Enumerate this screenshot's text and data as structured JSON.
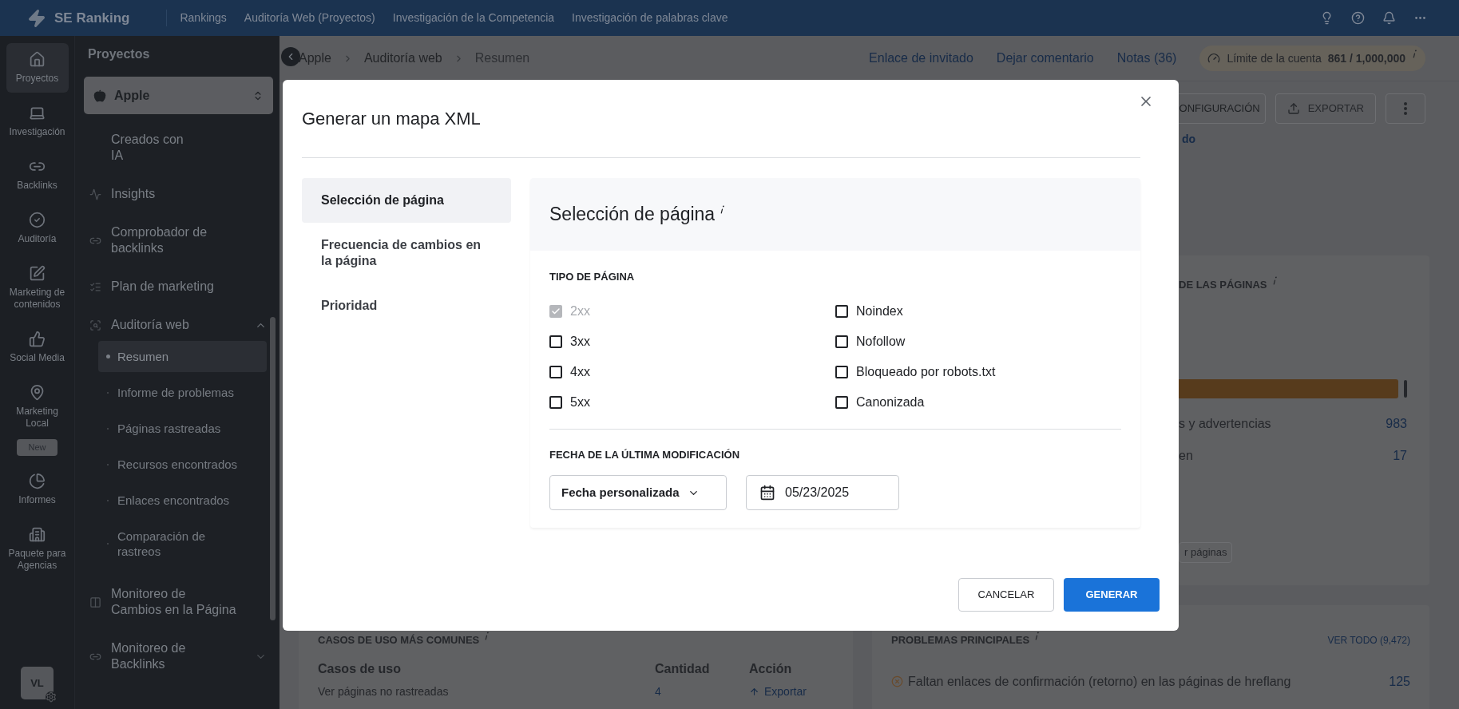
{
  "top_bar": {
    "logo": "SE Ranking",
    "nav": [
      "Rankings",
      "Auditoría Web (Proyectos)",
      "Investigación de la Competencia",
      "Investigación de palabras clave"
    ]
  },
  "icon_rail": {
    "items": [
      {
        "label": "Proyectos",
        "selected": true
      },
      {
        "label": "Investigación",
        "selected": false
      },
      {
        "label": "Backlinks",
        "selected": false
      },
      {
        "label": "Auditoría",
        "selected": false
      },
      {
        "label": "Marketing de contenidos",
        "selected": false
      },
      {
        "label": "Social Media",
        "selected": false
      },
      {
        "label": "Marketing Local",
        "selected": false,
        "badge": "New"
      },
      {
        "label": "Informes",
        "selected": false
      },
      {
        "label": "Paquete para Agencias",
        "selected": false
      }
    ],
    "avatar": "VL"
  },
  "sidebar": {
    "title": "Proyectos",
    "project": "Apple",
    "items": [
      {
        "label": "Creados con IA"
      },
      {
        "label": "Insights"
      },
      {
        "label": "Comprobador de backlinks"
      },
      {
        "label": "Plan de marketing"
      },
      {
        "label": "Auditoría web",
        "expanded": true,
        "children": [
          {
            "label": "Resumen",
            "selected": true
          },
          {
            "label": "Informe de problemas",
            "selected": false
          },
          {
            "label": "Páginas rastreadas",
            "selected": false
          },
          {
            "label": "Recursos encontrados",
            "selected": false
          },
          {
            "label": "Enlaces encontrados",
            "selected": false
          },
          {
            "label": "Comparación de rastreos",
            "selected": false
          }
        ]
      },
      {
        "label": "Monitoreo de Cambios en la Página"
      },
      {
        "label": "Monitoreo de Backlinks",
        "expanded": false
      }
    ]
  },
  "breadcrumb": [
    "Apple",
    "Auditoría web",
    "Resumen"
  ],
  "header_links": [
    "Enlace de invitado",
    "Dejar comentario",
    "Notas (36)"
  ],
  "account_limit": {
    "label": "Límite de la cuenta",
    "value": "861 / 1,000,000"
  },
  "toolbar": {
    "buttons": [
      "ONFIGURACIÓN",
      "EXPORTAR"
    ],
    "link": "do"
  },
  "health_card": {
    "title": "DE LAS PÁGINAS",
    "rows": [
      {
        "label": "s y advertencias",
        "value": "983"
      },
      {
        "label": "en",
        "value": "17"
      }
    ],
    "button": "r páginas"
  },
  "use_cases_card": {
    "title": "CASOS DE USO MÁS COMUNES",
    "columns": [
      "Casos de uso",
      "Cantidad",
      "Acción"
    ],
    "rows": [
      {
        "case": "Ver páginas no rastreadas",
        "count": "4",
        "action": "Exportar"
      }
    ]
  },
  "problems_card": {
    "title": "PROBLEMAS PRINCIPALES",
    "link": "VER TODO (9,472)",
    "rows": [
      {
        "text": "Faltan enlaces de confirmación (retorno) en las páginas de hreflang",
        "count": "125"
      }
    ]
  },
  "dialog": {
    "title": "Generar un mapa XML",
    "nav": [
      {
        "label": "Selección de página",
        "selected": true
      },
      {
        "label": "Frecuencia de cambios en la página",
        "selected": false
      },
      {
        "label": "Prioridad",
        "selected": false
      }
    ],
    "section_title": "Selección de página",
    "page_type": {
      "label": "TIPO DE PÁGINA",
      "options": [
        {
          "label": "2xx",
          "checked": true,
          "disabled": true
        },
        {
          "label": "3xx",
          "checked": false,
          "disabled": false
        },
        {
          "label": "4xx",
          "checked": false,
          "disabled": false
        },
        {
          "label": "5xx",
          "checked": false,
          "disabled": false
        },
        {
          "label": "Noindex",
          "checked": false,
          "disabled": false
        },
        {
          "label": "Nofollow",
          "checked": false,
          "disabled": false
        },
        {
          "label": "Bloqueado por robots.txt",
          "checked": false,
          "disabled": false
        },
        {
          "label": "Canonizada",
          "checked": false,
          "disabled": false
        }
      ]
    },
    "date": {
      "label": "FECHA DE LA ÚLTIMA MODIFICACIÓN",
      "mode": "Fecha personalizada",
      "value": "05/23/2025"
    },
    "buttons": {
      "cancel": "CANCELAR",
      "primary": "GENERAR"
    }
  }
}
